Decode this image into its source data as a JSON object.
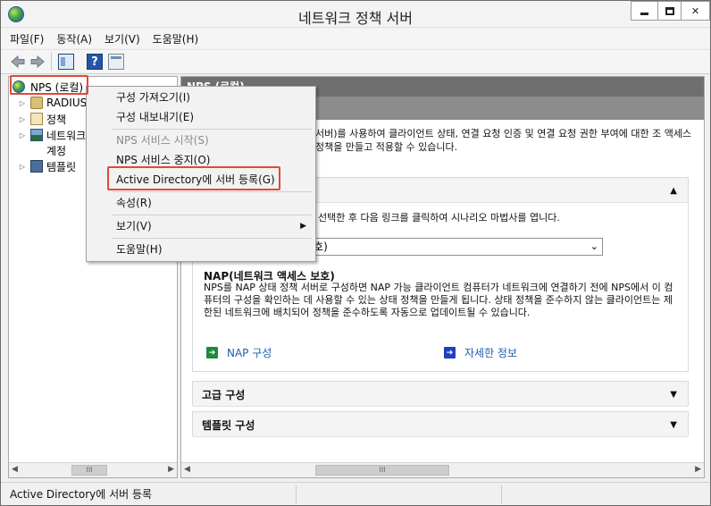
{
  "window": {
    "title": "네트워크 정책 서버"
  },
  "menubar": {
    "items": [
      "파일(F)",
      "동작(A)",
      "보기(V)",
      "도움말(H)"
    ]
  },
  "toolbar": {
    "help_label": "?"
  },
  "tree": {
    "root": "NPS (로컬)",
    "items": [
      "RADIUS",
      "정책",
      "네트워크",
      "계정",
      "템플릿"
    ]
  },
  "right_pane": {
    "header": "NPS (로컬)",
    "intro": "서버)를 사용하여 클라이언트 상태, 연결 요청 인증 및 연결 요청 권한 부여에 대한 조 액세스 정책을 만들고 적용할 수 있습니다.",
    "scenario_hint": "선택한 후 다음 링크를 클릭하여 시나리오 마법사를 엽니다.",
    "scenario_select": "보호)",
    "nap_title": "NAP(네트워크 액세스 보호)",
    "nap_desc": "NPS를 NAP 상태 정책 서버로 구성하면 NAP 가능 클라이언트 컴퓨터가 네트워크에 연결하기 전에 NPS에서 이 컴퓨터의 구성을 확인하는 데 사용할 수 있는 상태 정책을 만들게 됩니다. 상태 정책을 준수하지 않는 클라이언트는 제한된 네트워크에 배치되어 정책을 준수하도록 자동으로 업데이트될 수 있습니다.",
    "link_nap": "NAP 구성",
    "link_more": "자세한 정보",
    "advanced": "고급 구성",
    "templates": "템플릿 구성"
  },
  "context_menu": {
    "items": [
      {
        "label": "구성 가져오기(I)",
        "enabled": true
      },
      {
        "label": "구성 내보내기(E)",
        "enabled": true
      },
      {
        "label": "NPS 서비스 시작(S)",
        "enabled": false
      },
      {
        "label": "NPS 서비스 중지(O)",
        "enabled": true
      },
      {
        "label": "Active Directory에 서버 등록(G)",
        "enabled": true
      },
      {
        "label": "속성(R)",
        "enabled": true
      },
      {
        "label": "보기(V)",
        "enabled": true
      },
      {
        "label": "도움말(H)",
        "enabled": true
      }
    ]
  },
  "scrollbar": {
    "thumb_label": "III"
  },
  "status": {
    "text": "Active Directory에 서버 등록"
  },
  "colors": {
    "highlight": "#e0493a",
    "header_bg": "#6f6f6f",
    "link": "#1b5fb0"
  }
}
